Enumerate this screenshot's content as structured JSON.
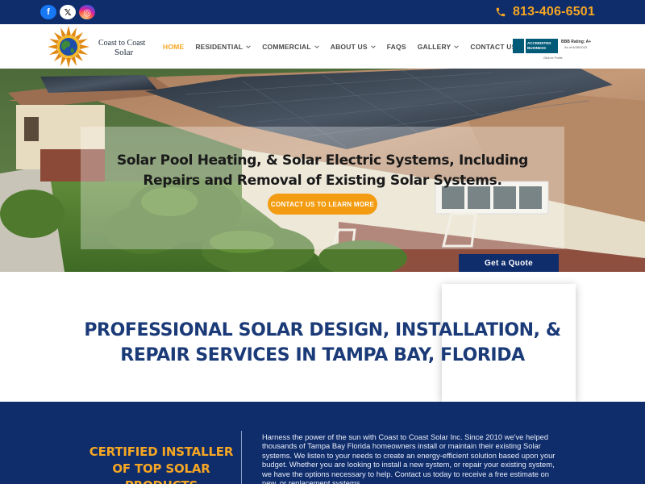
{
  "topbar": {
    "social": {
      "facebook_glyph": "f",
      "x_glyph": "𝕏",
      "instagram_glyph": "◎"
    },
    "phone": "813-406-6501",
    "colors": {
      "bar": "#0f2c6b",
      "phone": "#f5a623"
    }
  },
  "nav": {
    "brand_line1": "Coast to Coast",
    "brand_line2": "Solar",
    "items": [
      {
        "label": "HOME",
        "active": true,
        "dropdown": false
      },
      {
        "label": "RESIDENTIAL",
        "active": false,
        "dropdown": true
      },
      {
        "label": "COMMERCIAL",
        "active": false,
        "dropdown": true
      },
      {
        "label": "ABOUT US",
        "active": false,
        "dropdown": true
      },
      {
        "label": "FAQS",
        "active": false,
        "dropdown": false
      },
      {
        "label": "GALLERY",
        "active": false,
        "dropdown": true
      },
      {
        "label": "CONTACT US",
        "active": false,
        "dropdown": false
      }
    ],
    "bbb": {
      "badge_text": "ACCREDITED BUSINESS",
      "rating": "BBB Rating: A+",
      "as_of": "As of 8/28/2023",
      "profile": "Click for Profile"
    }
  },
  "hero": {
    "title": "Solar Pool Heating, & Solar Electric Systems, Including Repairs and Removal of Existing Solar Systems.",
    "cta_label": "CONTACT US TO LEARN MORE",
    "quote_label": "Get a Quote",
    "colors": {
      "cta": "#f39c12",
      "quote": "#0f2c6b"
    }
  },
  "intro": {
    "heading": "PROFESSIONAL SOLAR DESIGN, INSTALLATION, & REPAIR SERVICES IN TAMPA BAY, FLORIDA",
    "color": "#1b3a78"
  },
  "bottom": {
    "cert_heading": "CERTIFIED INSTALLER OF TOP SOLAR PRODUCTS",
    "about_text": "Harness the power of the sun with Coast to Coast Solar Inc. Since 2010 we've helped thousands of  Tampa Bay Florida homeowners install or maintain their existing Solar systems. We listen to your needs to create an energy-efficient solution based upon your budget. Whether you are looking to install a new system, or repair your existing system, we have the options necessary to help. Contact us today to receive a free estimate on new, or replacement systems.",
    "colors": {
      "background": "#0f2c6b",
      "heading": "#f5a623"
    }
  }
}
